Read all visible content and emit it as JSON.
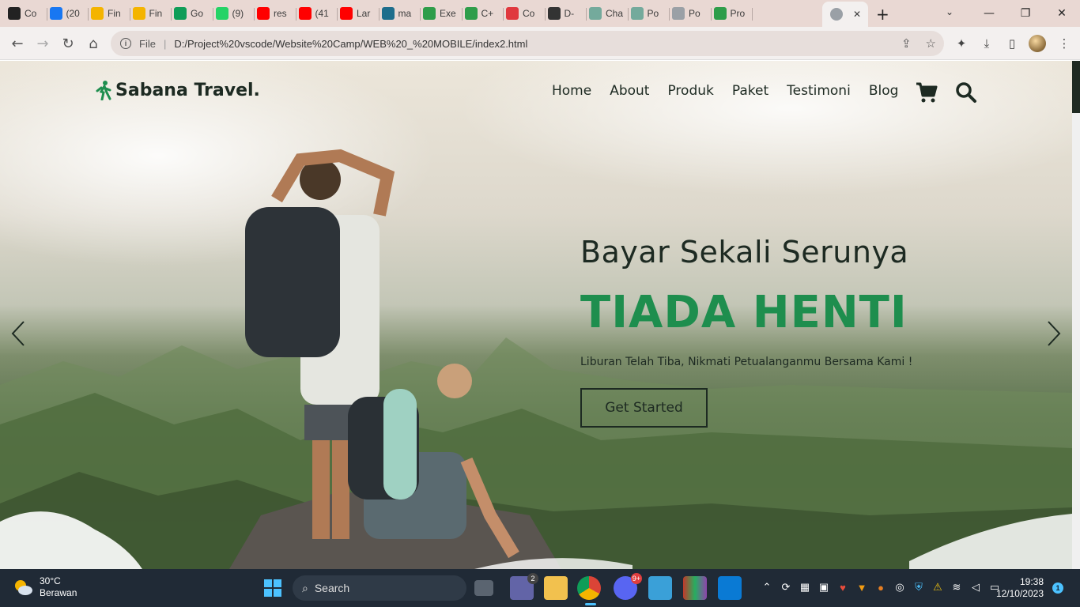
{
  "browser": {
    "tabs": [
      {
        "label": "Co",
        "color": "#222222"
      },
      {
        "label": "(20",
        "color": "#1877f2"
      },
      {
        "label": "Fin",
        "color": "#f4b400"
      },
      {
        "label": "Fin",
        "color": "#f4b400"
      },
      {
        "label": "Go",
        "color": "#0f9d58"
      },
      {
        "label": "(9)",
        "color": "#25d366"
      },
      {
        "label": "res",
        "color": "#ff0000"
      },
      {
        "label": "(41",
        "color": "#ff0000"
      },
      {
        "label": "Lar",
        "color": "#ff0000"
      },
      {
        "label": "ma",
        "color": "#1e6e8c"
      },
      {
        "label": "Exe",
        "color": "#2e9d4a"
      },
      {
        "label": "C+",
        "color": "#2e9d4a"
      },
      {
        "label": "Co",
        "color": "#e0383e"
      },
      {
        "label": "D-",
        "color": "#333333"
      },
      {
        "label": "Cha",
        "color": "#74aa9c"
      },
      {
        "label": "Po",
        "color": "#74aa9c"
      },
      {
        "label": "Po",
        "color": "#9aa0a6"
      },
      {
        "label": "Pro",
        "color": "#2e9d4a"
      }
    ],
    "active_tab_close": "✕",
    "new_tab": "+",
    "address": {
      "scheme": "File",
      "url": "D:/Project%20vscode/Website%20Camp/WEB%20_%20MOBILE/index2.html"
    }
  },
  "site": {
    "brand": "Sabana Travel.",
    "menu": [
      "Home",
      "About",
      "Produk",
      "Paket",
      "Testimoni",
      "Blog"
    ],
    "icons": [
      "cart-icon",
      "search-icon"
    ],
    "hero": {
      "subtitle": "Bayar Sekali Serunya",
      "title": "TIADA HENTI",
      "description": "Liburan Telah Tiba, Nikmati Petualanganmu Bersama Kami !",
      "cta": "Get Started"
    },
    "colors": {
      "accent": "#1e8e4e",
      "text": "#1d2a22"
    }
  },
  "taskbar": {
    "weather": {
      "temp": "30°C",
      "condition": "Berawan"
    },
    "search_label": "Search",
    "badges": {
      "teams": "2",
      "discord": "9+"
    },
    "clock": {
      "time": "19:38",
      "date": "12/10/2023"
    },
    "notifications": "1"
  }
}
